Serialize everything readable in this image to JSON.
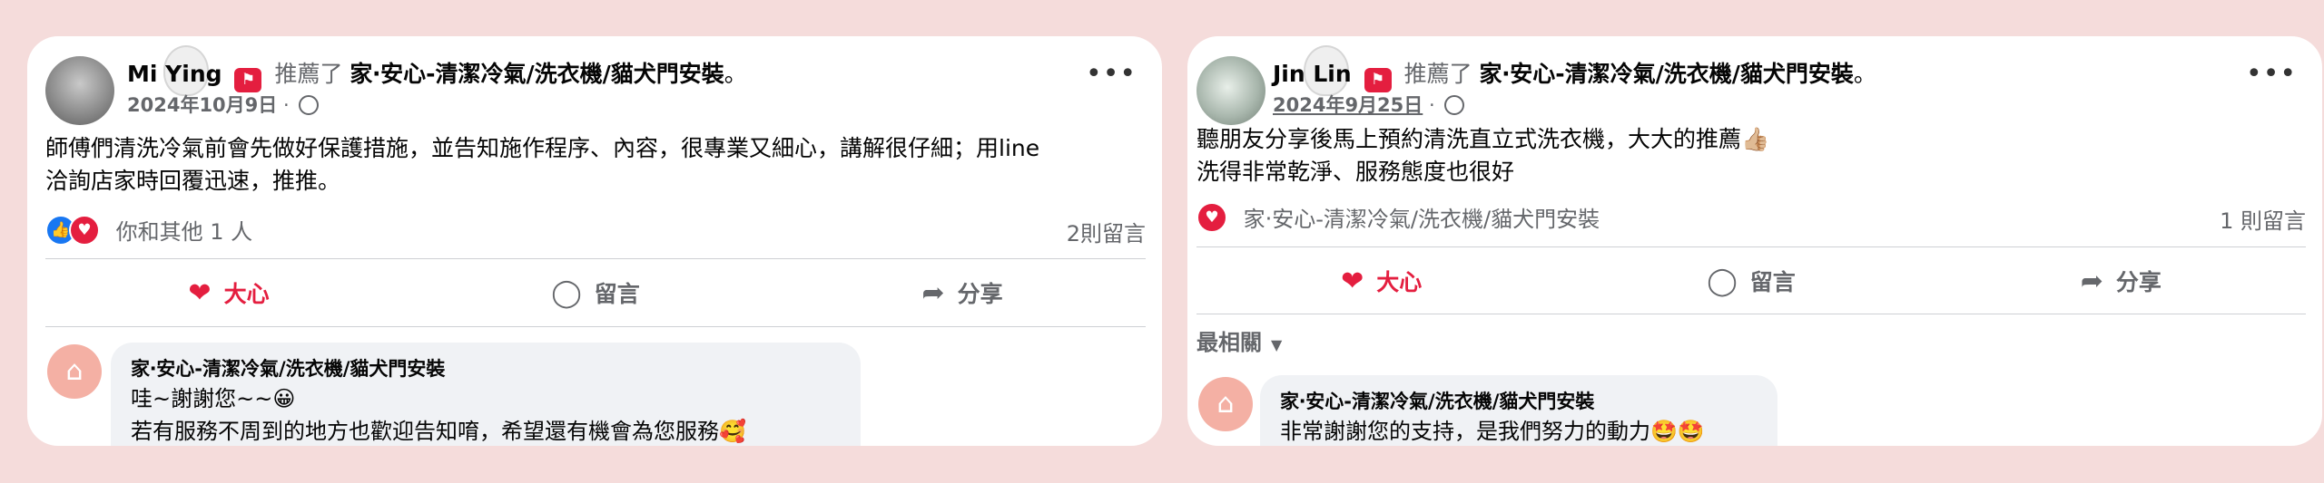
{
  "posts": [
    {
      "author": "Mi Ying",
      "verb": "推薦了",
      "page": "家‧安心-清潔冷氣/洗衣機/貓犬門安裝",
      "period": "。",
      "date": "2024年10月9日",
      "separator": "·",
      "more_label": "•••",
      "body": [
        "師傅們清洗冷氣前會先做好保護措施，並告知施作程序、內容，很專業又細心，講解很仔細；用line",
        "洽詢店家時回覆迅速，推推。"
      ],
      "reactions_text": "你和其他 1 人",
      "comments_count": "2則留言",
      "actions": {
        "love": "大心",
        "comment": "留言",
        "share": "分享"
      },
      "reply": {
        "author": "家‧安心-清潔冷氣/洗衣機/貓犬門安裝",
        "lines": [
          "哇~謝謝您~~😀",
          "若有服務不周到的地方也歡迎告知唷，希望還有機會為您服務🥰"
        ]
      }
    },
    {
      "author": "Jin Lin",
      "verb": "推薦了",
      "page": "家‧安心-清潔冷氣/洗衣機/貓犬門安裝",
      "period": "。",
      "date": "2024年9月25日",
      "separator": "·",
      "more_label": "•••",
      "body": [
        "聽朋友分享後馬上預約清洗直立式洗衣機，大大的推薦👍🏼",
        "洗得非常乾淨、服務態度也很好"
      ],
      "reactions_text": "家‧安心-清潔冷氣/洗衣機/貓犬門安裝",
      "comments_count": "1 則留言",
      "actions": {
        "love": "大心",
        "comment": "留言",
        "share": "分享"
      },
      "sort_label": "最相關",
      "reply": {
        "author": "家‧安心-清潔冷氣/洗衣機/貓犬門安裝",
        "lines": [
          "非常謝謝您的支持，是我們努力的動力🤩🤩"
        ]
      }
    }
  ],
  "icons": {
    "badge": "recommend-badge-icon",
    "globe": "globe-icon",
    "like": "thumbs-up-icon",
    "love": "heart-icon",
    "comment": "comment-bubble-icon",
    "share": "share-arrow-icon",
    "chevron": "chevron-down-icon",
    "page_avatar": "house-icon"
  },
  "colors": {
    "background": "#f5dcdb",
    "love_red": "#e41e3f",
    "like_blue": "#1877f2",
    "muted_text": "#65676b",
    "bubble_bg": "#f0f2f5"
  }
}
